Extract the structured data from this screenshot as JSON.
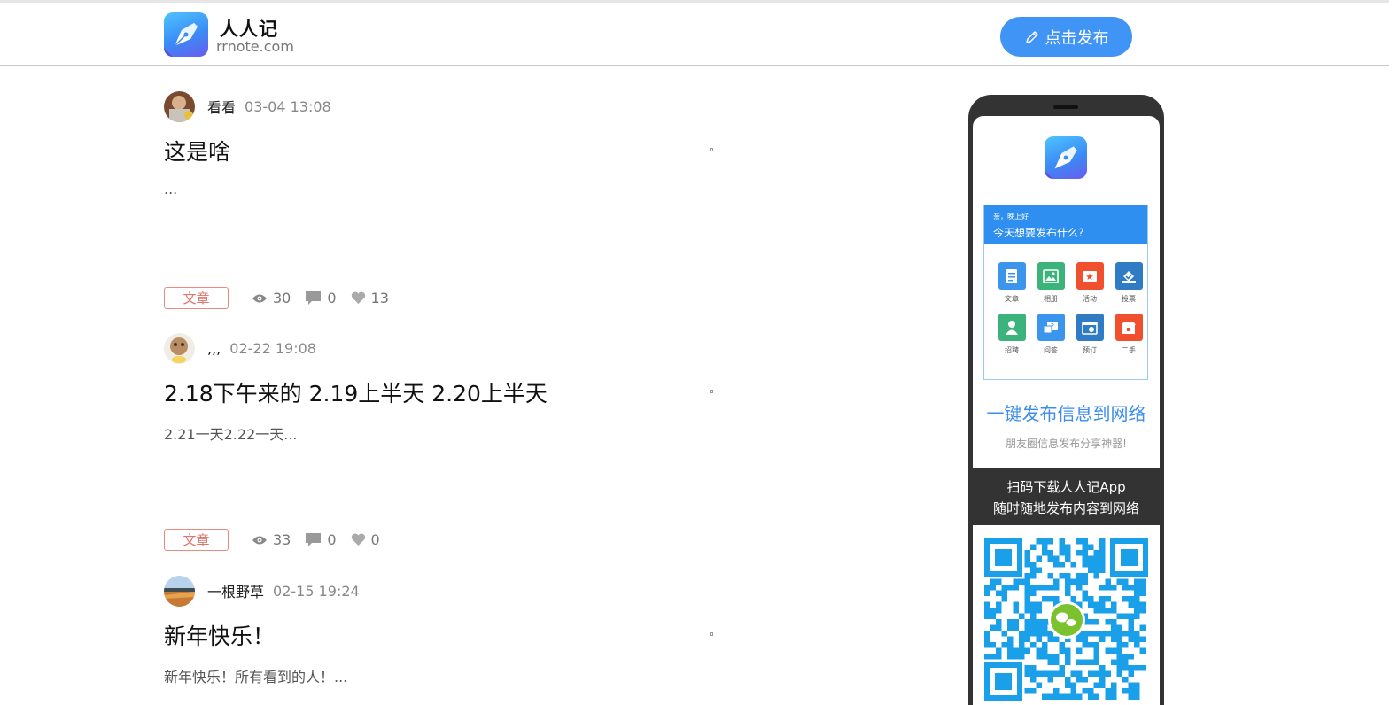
{
  "header": {
    "brand_name": "人人记",
    "brand_url": "rrnote.com",
    "publish_label": "点击发布",
    "logo_icon": "pen-nib-icon"
  },
  "posts": [
    {
      "author": "看看",
      "time": "03-04 13:08",
      "title": "这是啥",
      "excerpt": "...",
      "tag": "文章",
      "views": "30",
      "comments": "0",
      "likes": "13"
    },
    {
      "author": ",,,",
      "time": "02-22 19:08",
      "title": "2.18下午来的 2.19上半天 2.20上半天",
      "excerpt": "2.21一天2.22一天...",
      "tag": "文章",
      "views": "33",
      "comments": "0",
      "likes": "0"
    },
    {
      "author": "一根野草",
      "time": "02-15 19:24",
      "title": "新年快乐！",
      "excerpt": "新年快乐！所有看到的人！..."
    }
  ],
  "promo": {
    "greeting": "亲，晚上好",
    "question": "今天想要发布什么？",
    "categories": [
      {
        "label": "文章",
        "color": "#3b95ec",
        "icon": "article-icon"
      },
      {
        "label": "相册",
        "color": "#3cb37a",
        "icon": "album-icon"
      },
      {
        "label": "活动",
        "color": "#f0502e",
        "icon": "event-icon"
      },
      {
        "label": "投票",
        "color": "#2f7cc4",
        "icon": "vote-icon"
      },
      {
        "label": "招聘",
        "color": "#3cb37a",
        "icon": "recruit-icon"
      },
      {
        "label": "问答",
        "color": "#3b95ec",
        "icon": "qa-icon"
      },
      {
        "label": "预订",
        "color": "#2f7cc4",
        "icon": "booking-icon"
      },
      {
        "label": "二手",
        "color": "#f0502e",
        "icon": "secondhand-icon"
      }
    ],
    "slogan": "一键发布信息到网络",
    "sub_slogan": "朋友圈信息发布分享神器!",
    "download_line1": "扫码下载人人记App",
    "download_line2": "随时随地发布内容到网络"
  },
  "colors": {
    "accent": "#3f94f5",
    "tag": "#e0736a",
    "phone": "#333333",
    "qr": "#1aa0e8"
  }
}
